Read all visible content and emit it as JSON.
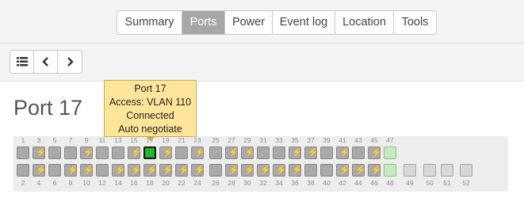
{
  "tabs": [
    {
      "label": "Summary",
      "active": false
    },
    {
      "label": "Ports",
      "active": true
    },
    {
      "label": "Power",
      "active": false
    },
    {
      "label": "Event log",
      "active": false
    },
    {
      "label": "Location",
      "active": false
    },
    {
      "label": "Tools",
      "active": false
    }
  ],
  "toolbar": {
    "buttons": [
      {
        "name": "list-icon"
      },
      {
        "name": "chevron-left-icon"
      },
      {
        "name": "chevron-right-icon"
      }
    ]
  },
  "page": {
    "title": "Port 17"
  },
  "tooltip": {
    "lines": [
      "Port 17",
      "Access: VLAN 110",
      "Connected",
      "Auto negotiate"
    ]
  },
  "switch": {
    "top_labels": [
      "1",
      "3",
      "5",
      "7",
      "9",
      "11",
      "13",
      "15",
      "17",
      "19",
      "21",
      "23",
      "25",
      "27",
      "29",
      "31",
      "33",
      "35",
      "37",
      "39",
      "41",
      "43",
      "45",
      "47"
    ],
    "bottom_labels": [
      "2",
      "4",
      "6",
      "8",
      "10",
      "12",
      "14",
      "16",
      "18",
      "20",
      "22",
      "24",
      "26",
      "28",
      "30",
      "32",
      "34",
      "36",
      "38",
      "40",
      "42",
      "44",
      "46",
      "48",
      "49",
      "50",
      "51",
      "52"
    ],
    "top_ports": [
      "gray",
      "poe",
      "gray",
      "gray",
      "poe",
      "gray",
      "gray",
      "poe",
      "active",
      "poe",
      "gray",
      "poe",
      "gray",
      "poe",
      "poe",
      "gray",
      "gray",
      "poe",
      "poe",
      "gray",
      "poe",
      "gray",
      "poe",
      "light"
    ],
    "bottom_ports": [
      "gray",
      "poe",
      "gray",
      "poe",
      "poe",
      "gray",
      "poe",
      "poe",
      "poe",
      "poe",
      "poe",
      "poe",
      "gray",
      "poe",
      "poe",
      "poe",
      "poe",
      "poe",
      "gray",
      "gray",
      "poe",
      "poe",
      "poe",
      "light",
      "uplink",
      "uplink",
      "uplink",
      "uplink"
    ],
    "colors": {
      "active": "#1fb52d",
      "poe_bolt": "#d8cd3a",
      "gray": "#a9a9a9",
      "light": "#c6eac0"
    }
  }
}
